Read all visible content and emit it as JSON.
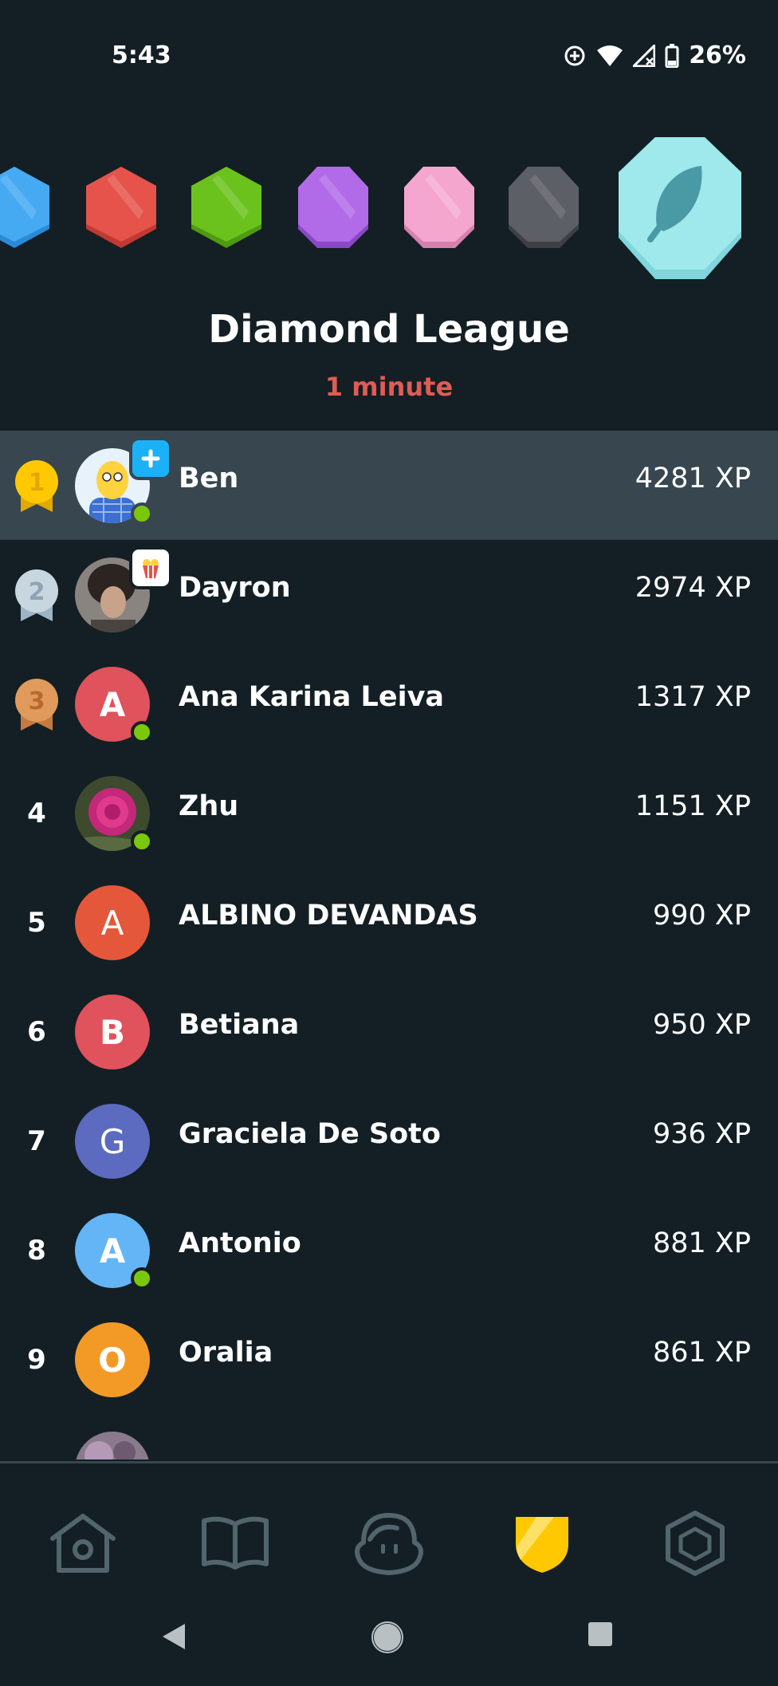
{
  "status_bar": {
    "time": "5:43",
    "battery": "26%",
    "icons": [
      "data-saver-icon",
      "wifi-icon",
      "signal-icon",
      "battery-icon"
    ]
  },
  "league": {
    "title": "Diamond League",
    "time_remaining": "1 minute",
    "badge_colors": [
      "#45aaf2",
      "#e5534b",
      "#6cc21d",
      "#b16be8",
      "#f4a6cf",
      "#5d5f66",
      "#9fe8ec"
    ],
    "current_badge_icon": "feather-icon"
  },
  "leaderboard": [
    {
      "rank": "1",
      "name": "Ben",
      "xp": "4281 XP",
      "avatar_letter": "",
      "avatar_color": "#e7f2fb",
      "online": true,
      "medal": "gold",
      "highlight": true
    },
    {
      "rank": "2",
      "name": "Dayron",
      "xp": "2974 XP",
      "avatar_letter": "",
      "avatar_color": "#6e6864",
      "online": false,
      "medal": "silver",
      "highlight": false
    },
    {
      "rank": "3",
      "name": "Ana Karina Leiva",
      "xp": "1317 XP",
      "avatar_letter": "A",
      "avatar_color": "#e0525c",
      "online": true,
      "medal": "bronze",
      "highlight": false
    },
    {
      "rank": "4",
      "name": "Zhu",
      "xp": "1151 XP",
      "avatar_letter": "",
      "avatar_color": "#3a2a2e",
      "online": true,
      "medal": "",
      "highlight": false
    },
    {
      "rank": "5",
      "name": "ALBINO DEVANDAS",
      "xp": "990 XP",
      "avatar_letter": "A",
      "avatar_color": "#e5573a",
      "online": false,
      "medal": "",
      "highlight": false
    },
    {
      "rank": "6",
      "name": "Betiana",
      "xp": "950 XP",
      "avatar_letter": "B",
      "avatar_color": "#e0525c",
      "online": false,
      "medal": "",
      "highlight": false
    },
    {
      "rank": "7",
      "name": "Graciela De Soto",
      "xp": "936 XP",
      "avatar_letter": "G",
      "avatar_color": "#5c6bc0",
      "online": false,
      "medal": "",
      "highlight": false
    },
    {
      "rank": "8",
      "name": "Antonio",
      "xp": "881 XP",
      "avatar_letter": "A",
      "avatar_color": "#64b5f6",
      "online": true,
      "medal": "",
      "highlight": false
    },
    {
      "rank": "9",
      "name": "Oralia",
      "xp": "861 XP",
      "avatar_letter": "O",
      "avatar_color": "#f39a26",
      "online": false,
      "medal": "",
      "highlight": false
    }
  ],
  "bottom_nav": {
    "items": [
      "home-icon",
      "learn-book-icon",
      "character-icon",
      "leaderboard-shield-icon",
      "more-hexagon-icon"
    ],
    "active": "leaderboard-shield-icon",
    "active_color": "#ffc800"
  }
}
